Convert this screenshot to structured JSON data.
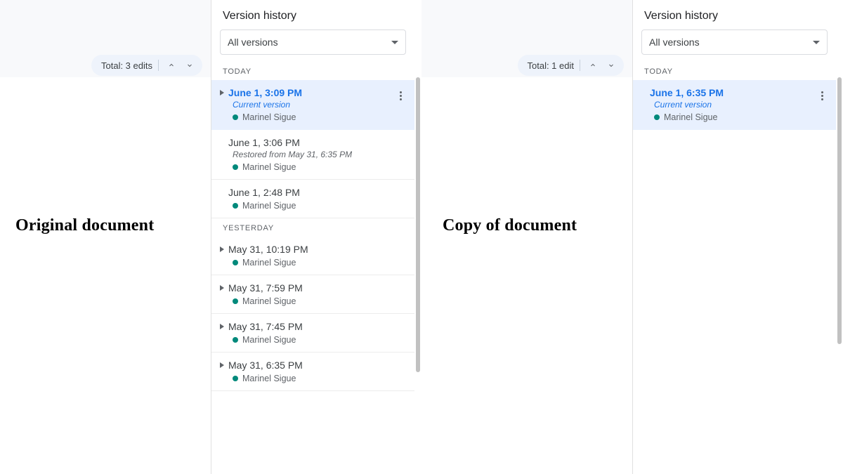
{
  "left": {
    "caption": "Original document",
    "pill_label": "Total: 3 edits",
    "panel_title": "Version history",
    "filter_label": "All versions",
    "groups": [
      {
        "header": "TODAY",
        "entries": [
          {
            "time": "June 1, 3:09 PM",
            "subtitle": "Current version",
            "author": "Marinel Sigue",
            "selected": true,
            "expandable": true,
            "kebab": true
          },
          {
            "time": "June 1, 3:06 PM",
            "subtitle": "Restored from May 31, 6:35 PM",
            "author": "Marinel Sigue",
            "selected": false,
            "expandable": false,
            "kebab": false
          },
          {
            "time": "June 1, 2:48 PM",
            "subtitle": "",
            "author": "Marinel Sigue",
            "selected": false,
            "expandable": false,
            "kebab": false
          }
        ]
      },
      {
        "header": "YESTERDAY",
        "entries": [
          {
            "time": "May 31, 10:19 PM",
            "subtitle": "",
            "author": "Marinel Sigue",
            "selected": false,
            "expandable": true,
            "kebab": false
          },
          {
            "time": "May 31, 7:59 PM",
            "subtitle": "",
            "author": "Marinel Sigue",
            "selected": false,
            "expandable": true,
            "kebab": false
          },
          {
            "time": "May 31, 7:45 PM",
            "subtitle": "",
            "author": "Marinel Sigue",
            "selected": false,
            "expandable": true,
            "kebab": false
          },
          {
            "time": "May 31, 6:35 PM",
            "subtitle": "",
            "author": "Marinel Sigue",
            "selected": false,
            "expandable": true,
            "kebab": false
          }
        ]
      }
    ]
  },
  "right": {
    "caption": "Copy of document",
    "pill_label": "Total: 1 edit",
    "panel_title": "Version history",
    "filter_label": "All versions",
    "groups": [
      {
        "header": "TODAY",
        "entries": [
          {
            "time": "June 1, 6:35 PM",
            "subtitle": "Current version",
            "author": "Marinel Sigue",
            "selected": true,
            "expandable": false,
            "kebab": true
          }
        ]
      }
    ]
  },
  "colors": {
    "accent": "#1a73e8",
    "author_dot": "#00897b"
  }
}
